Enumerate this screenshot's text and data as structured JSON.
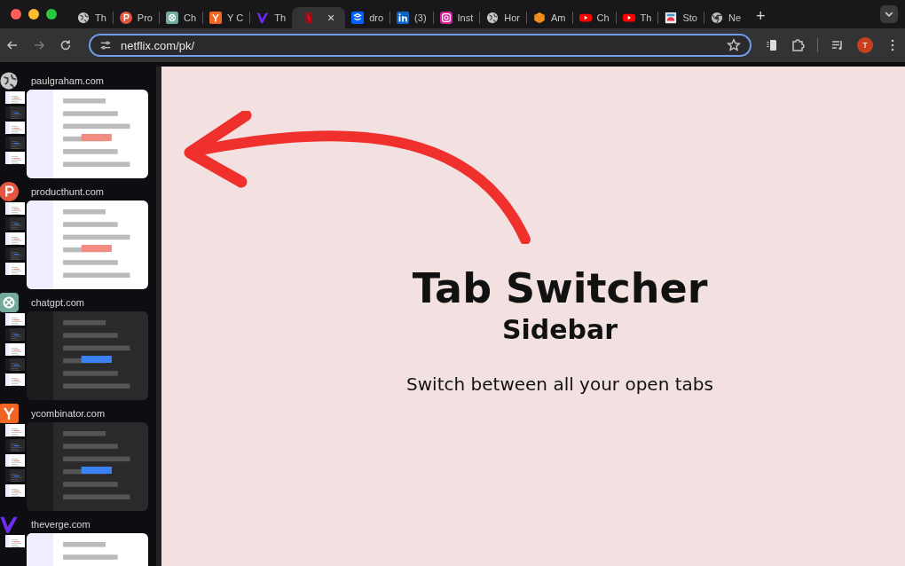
{
  "tabs": [
    {
      "label": "Th",
      "selected": false
    },
    {
      "label": "Pro",
      "selected": false
    },
    {
      "label": "Ch",
      "selected": false
    },
    {
      "label": "Y C",
      "selected": false
    },
    {
      "label": "Th",
      "selected": false
    },
    {
      "close": "×",
      "selected": true
    },
    {
      "label": "dro",
      "selected": false
    },
    {
      "label": "(3)",
      "selected": false
    },
    {
      "label": "Inst",
      "selected": false
    },
    {
      "label": "Hor",
      "selected": false
    },
    {
      "label": "Am",
      "selected": false
    },
    {
      "label": "Ch",
      "selected": false
    },
    {
      "label": "Th",
      "selected": false
    },
    {
      "label": "Sto",
      "selected": false
    },
    {
      "label": "Ne",
      "selected": false
    }
  ],
  "new_tab": "+",
  "address_bar": {
    "value": "netflix.com/pk/"
  },
  "profile": {
    "initial": "T"
  },
  "sidebar": {
    "items": [
      {
        "domain": "paulgraham.com"
      },
      {
        "domain": "producthunt.com"
      },
      {
        "domain": "chatgpt.com"
      },
      {
        "domain": "ycombinator.com"
      },
      {
        "domain": "theverge.com"
      }
    ]
  },
  "content": {
    "title": "Tab Switcher",
    "subtitle": "Sidebar",
    "tagline": "Switch between all your open tabs"
  }
}
